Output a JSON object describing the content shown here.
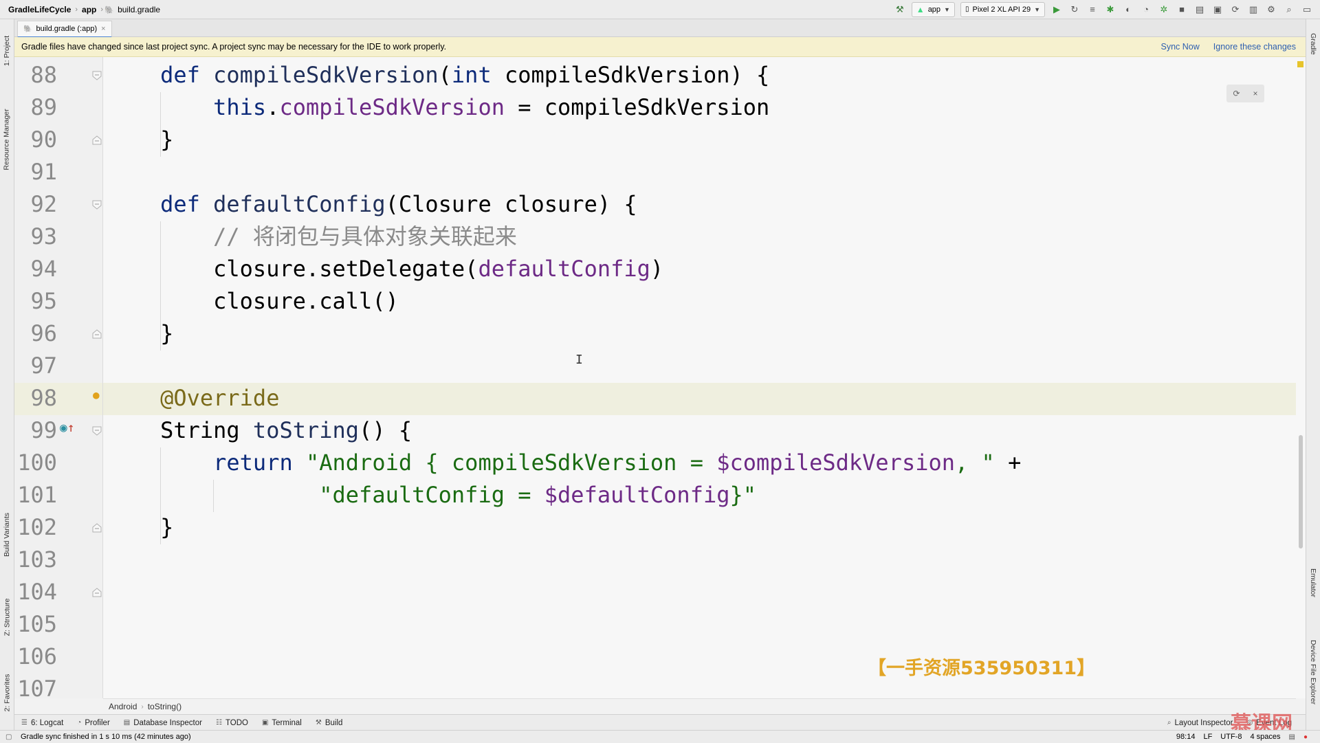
{
  "navbar": {
    "breadcrumbs": [
      "GradleLifeCycle",
      "app",
      "build.gradle"
    ]
  },
  "toolbar": {
    "module_combo": "app",
    "device_combo": "Pixel 2 XL API 29"
  },
  "left_strip": {
    "tabs": [
      "1: Project",
      "Resource Manager",
      "Build Variants",
      "Z: Structure",
      "2: Favorites"
    ]
  },
  "right_strip": {
    "tabs": [
      "Gradle",
      "Emulator",
      "Device File Explorer"
    ]
  },
  "editor_tab": {
    "label": "build.gradle (:app)"
  },
  "notice": {
    "message": "Gradle files have changed since last project sync. A project sync may be necessary for the IDE to work properly.",
    "sync_now": "Sync Now",
    "ignore": "Ignore these changes"
  },
  "code": {
    "lines": [
      {
        "n": "88",
        "segs": [
          {
            "t": "    "
          },
          {
            "t": "def",
            "c": "k"
          },
          {
            "t": " "
          },
          {
            "t": "compileSdkVersion",
            "c": "m"
          },
          {
            "t": "("
          },
          {
            "t": "int",
            "c": "k"
          },
          {
            "t": " compileSdkVersion) {"
          }
        ]
      },
      {
        "n": "89",
        "segs": [
          {
            "t": "        "
          },
          {
            "t": "this",
            "c": "k"
          },
          {
            "t": "."
          },
          {
            "t": "compileSdkVersion",
            "c": "f"
          },
          {
            "t": " = compileSdkVersion"
          }
        ]
      },
      {
        "n": "90",
        "segs": [
          {
            "t": "    }"
          }
        ]
      },
      {
        "n": "91",
        "segs": [
          {
            "t": ""
          }
        ]
      },
      {
        "n": "92",
        "segs": [
          {
            "t": "    "
          },
          {
            "t": "def",
            "c": "k"
          },
          {
            "t": " "
          },
          {
            "t": "defaultConfig",
            "c": "m"
          },
          {
            "t": "(Closure closure) {"
          }
        ]
      },
      {
        "n": "93",
        "segs": [
          {
            "t": "        "
          },
          {
            "t": "// 将闭包与具体对象关联起来",
            "c": "c"
          }
        ]
      },
      {
        "n": "94",
        "segs": [
          {
            "t": "        closure.setDelegate("
          },
          {
            "t": "defaultConfig",
            "c": "f"
          },
          {
            "t": ")"
          }
        ]
      },
      {
        "n": "95",
        "segs": [
          {
            "t": "        closure.call()"
          }
        ]
      },
      {
        "n": "96",
        "segs": [
          {
            "t": "    }"
          }
        ]
      },
      {
        "n": "97",
        "segs": [
          {
            "t": ""
          }
        ]
      },
      {
        "n": "98",
        "segs": [
          {
            "t": "    "
          },
          {
            "t": "@Override",
            "c": "a"
          }
        ]
      },
      {
        "n": "99",
        "segs": [
          {
            "t": "    String "
          },
          {
            "t": "toString",
            "c": "m"
          },
          {
            "t": "() {"
          }
        ]
      },
      {
        "n": "100",
        "segs": [
          {
            "t": "        "
          },
          {
            "t": "return",
            "c": "k"
          },
          {
            "t": " "
          },
          {
            "t": "\"Android { compileSdkVersion = ",
            "c": "s"
          },
          {
            "t": "$compileSdkVersion",
            "c": "f"
          },
          {
            "t": ", \"",
            "c": "s"
          },
          {
            "t": " +"
          }
        ]
      },
      {
        "n": "101",
        "segs": [
          {
            "t": "                "
          },
          {
            "t": "\"defaultConfig = ",
            "c": "s"
          },
          {
            "t": "$defaultConfig",
            "c": "f"
          },
          {
            "t": "}\"",
            "c": "s"
          }
        ]
      },
      {
        "n": "102",
        "segs": [
          {
            "t": "    }"
          }
        ]
      },
      {
        "n": "103",
        "segs": [
          {
            "t": ""
          }
        ]
      },
      {
        "n": "104",
        "segs": [
          {
            "t": "}"
          }
        ]
      },
      {
        "n": "105",
        "segs": [
          {
            "t": ""
          }
        ]
      },
      {
        "n": "106",
        "segs": [
          {
            "t": ""
          }
        ]
      },
      {
        "n": "107",
        "segs": [
          {
            "t": ""
          }
        ]
      }
    ]
  },
  "editor_breadcrumb": [
    "Android",
    "toString()"
  ],
  "toolwindows": {
    "left": [
      "6: Logcat",
      "Profiler",
      "Database Inspector",
      "TODO",
      "Terminal",
      "Build"
    ],
    "right": [
      "Layout Inspector",
      "Event Log"
    ]
  },
  "status": {
    "message": "Gradle sync finished in 1 s 10 ms (42 minutes ago)",
    "position": "98:14",
    "line_sep": "LF",
    "encoding": "UTF-8",
    "indent": "4 spaces"
  },
  "watermark": "【一手资源535950311】",
  "brand": "慕课网"
}
